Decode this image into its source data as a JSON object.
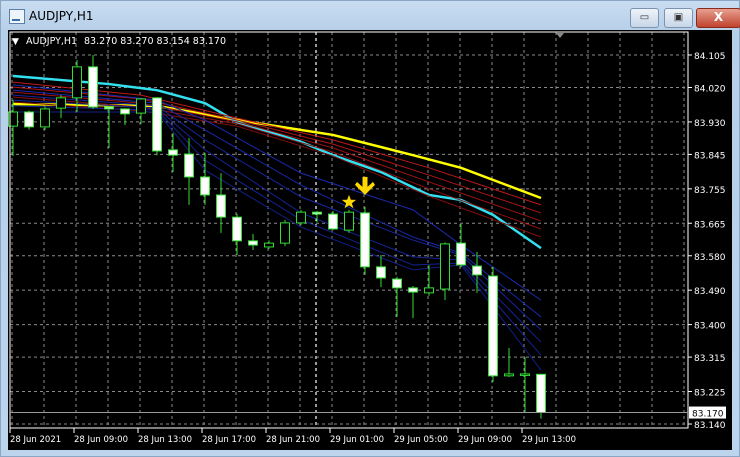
{
  "window": {
    "title": "AUDJPY,H1",
    "minimize_label": "▭",
    "maximize_label": "▣",
    "close_label": "X"
  },
  "chart_header": {
    "symbol": "AUDJPY,H1",
    "ohlc": "83.270 83.270 83.154 83.170"
  },
  "colors": {
    "background": "#000000",
    "candle_outline": "#33dd33",
    "bear_body": "#ffffff",
    "bull_body": "#000000",
    "ma_yellow": "#ffff00",
    "ma_cyan": "#33e0f0",
    "ma_red": "#c01818",
    "ma_blue": "#1020a0",
    "grid": "#8a8a8a"
  },
  "chart_data": {
    "type": "candlestick",
    "symbol": "AUDJPY",
    "timeframe": "H1",
    "ylim": [
      83.14,
      84.105
    ],
    "yticks": [
      "84.105",
      "84.020",
      "83.930",
      "83.845",
      "83.755",
      "83.665",
      "83.580",
      "83.490",
      "83.400",
      "83.315",
      "83.225",
      "83.140"
    ],
    "current_price": "83.170",
    "xtick_labels": [
      {
        "index": 0,
        "label": "28 Jun 2021"
      },
      {
        "index": 4,
        "label": "28 Jun 09:00"
      },
      {
        "index": 8,
        "label": "28 Jun 13:00"
      },
      {
        "index": 12,
        "label": "28 Jun 17:00"
      },
      {
        "index": 16,
        "label": "28 Jun 21:00"
      },
      {
        "index": 20,
        "label": "29 Jun 01:00"
      },
      {
        "index": 24,
        "label": "29 Jun 05:00"
      },
      {
        "index": 28,
        "label": "29 Jun 09:00"
      },
      {
        "index": 32,
        "label": "29 Jun 13:00"
      }
    ],
    "candles": [
      [
        83.919,
        83.987,
        83.841,
        83.956
      ],
      [
        83.956,
        83.96,
        83.91,
        83.917
      ],
      [
        83.917,
        83.97,
        83.909,
        83.964
      ],
      [
        83.966,
        84.0,
        83.94,
        83.993
      ],
      [
        83.993,
        84.092,
        83.956,
        84.074
      ],
      [
        84.074,
        84.105,
        83.964,
        83.969
      ],
      [
        83.969,
        83.972,
        83.862,
        83.964
      ],
      [
        83.964,
        83.966,
        83.922,
        83.951
      ],
      [
        83.953,
        83.993,
        83.925,
        83.99
      ],
      [
        83.993,
        83.995,
        83.843,
        83.854
      ],
      [
        83.857,
        83.901,
        83.799,
        83.843
      ],
      [
        83.846,
        83.888,
        83.713,
        83.786
      ],
      [
        83.786,
        83.849,
        83.713,
        83.739
      ],
      [
        83.739,
        83.796,
        83.64,
        83.681
      ],
      [
        83.681,
        83.69,
        83.582,
        83.619
      ],
      [
        83.619,
        83.637,
        83.595,
        83.608
      ],
      [
        83.603,
        83.62,
        83.598,
        83.613
      ],
      [
        83.613,
        83.674,
        83.605,
        83.666
      ],
      [
        83.666,
        83.7,
        83.66,
        83.694
      ],
      [
        83.694,
        83.697,
        83.668,
        83.689
      ],
      [
        83.689,
        83.697,
        83.647,
        83.65
      ],
      [
        83.647,
        83.7,
        83.64,
        83.694
      ],
      [
        83.692,
        83.708,
        83.53,
        83.551
      ],
      [
        83.551,
        83.582,
        83.498,
        83.522
      ],
      [
        83.519,
        83.525,
        83.42,
        83.496
      ],
      [
        83.496,
        83.501,
        83.417,
        83.485
      ],
      [
        83.483,
        83.556,
        83.475,
        83.496
      ],
      [
        83.493,
        83.615,
        83.464,
        83.611
      ],
      [
        83.613,
        83.663,
        83.55,
        83.556
      ],
      [
        83.553,
        83.59,
        83.483,
        83.53
      ],
      [
        83.527,
        83.551,
        83.25,
        83.266
      ],
      [
        83.266,
        83.339,
        83.263,
        83.271
      ],
      [
        83.271,
        83.315,
        83.171,
        83.271
      ],
      [
        83.27,
        83.27,
        83.154,
        83.17
      ]
    ],
    "moving_averages": [
      {
        "name": "yellow",
        "color": "#ffff00",
        "points": [
          [
            0,
            83.977
          ],
          [
            9,
            83.972
          ],
          [
            14,
            83.935
          ],
          [
            20,
            83.896
          ],
          [
            25,
            83.843
          ],
          [
            28,
            83.81
          ],
          [
            33,
            83.731
          ]
        ]
      },
      {
        "name": "cyan",
        "color": "#33e0f0",
        "points": [
          [
            0,
            84.05
          ],
          [
            6,
            84.029
          ],
          [
            9,
            84.013
          ],
          [
            12,
            83.979
          ],
          [
            14,
            83.93
          ],
          [
            18,
            83.878
          ],
          [
            20,
            83.843
          ],
          [
            23,
            83.799
          ],
          [
            26,
            83.739
          ],
          [
            28,
            83.726
          ],
          [
            30,
            83.687
          ],
          [
            33,
            83.6
          ]
        ]
      },
      {
        "name": "red-1",
        "color": "#c01818",
        "points": [
          [
            0,
            84.034
          ],
          [
            8,
            84.0
          ],
          [
            14,
            83.94
          ],
          [
            20,
            83.883
          ],
          [
            26,
            83.81
          ],
          [
            33,
            83.713
          ]
        ]
      },
      {
        "name": "red-2",
        "color": "#b01515",
        "points": [
          [
            0,
            84.021
          ],
          [
            8,
            83.99
          ],
          [
            14,
            83.935
          ],
          [
            20,
            83.872
          ],
          [
            26,
            83.791
          ],
          [
            33,
            83.692
          ]
        ]
      },
      {
        "name": "red-3",
        "color": "#a01212",
        "points": [
          [
            0,
            84.008
          ],
          [
            8,
            83.979
          ],
          [
            14,
            83.93
          ],
          [
            20,
            83.862
          ],
          [
            26,
            83.773
          ],
          [
            33,
            83.671
          ]
        ]
      },
      {
        "name": "red-4",
        "color": "#901010",
        "points": [
          [
            0,
            83.995
          ],
          [
            8,
            83.969
          ],
          [
            14,
            83.925
          ],
          [
            20,
            83.851
          ],
          [
            26,
            83.755
          ],
          [
            33,
            83.65
          ]
        ]
      },
      {
        "name": "red-5",
        "color": "#800e0e",
        "points": [
          [
            0,
            83.982
          ],
          [
            8,
            83.959
          ],
          [
            14,
            83.919
          ],
          [
            20,
            83.841
          ],
          [
            26,
            83.736
          ],
          [
            33,
            83.629
          ]
        ]
      },
      {
        "name": "blue-1",
        "color": "#1a2ab0",
        "points": [
          [
            0,
            84.027
          ],
          [
            9,
            83.987
          ],
          [
            12,
            83.935
          ],
          [
            18,
            83.796
          ],
          [
            25,
            83.7
          ],
          [
            28,
            83.608
          ],
          [
            33,
            83.464
          ]
        ]
      },
      {
        "name": "blue-2",
        "color": "#1828a8",
        "points": [
          [
            0,
            84.013
          ],
          [
            9,
            83.979
          ],
          [
            12,
            83.909
          ],
          [
            18,
            83.765
          ],
          [
            25,
            83.629
          ],
          [
            28,
            83.587
          ],
          [
            33,
            83.42
          ]
        ]
      },
      {
        "name": "blue-3",
        "color": "#1626a0",
        "points": [
          [
            0,
            84.0
          ],
          [
            9,
            83.972
          ],
          [
            12,
            83.883
          ],
          [
            18,
            83.734
          ],
          [
            25,
            83.621
          ],
          [
            28,
            83.582
          ],
          [
            33,
            83.386
          ]
        ]
      },
      {
        "name": "blue-4",
        "color": "#142498",
        "points": [
          [
            0,
            83.987
          ],
          [
            9,
            83.966
          ],
          [
            12,
            83.857
          ],
          [
            18,
            83.692
          ],
          [
            25,
            83.577
          ],
          [
            28,
            83.569
          ],
          [
            33,
            83.354
          ]
        ]
      },
      {
        "name": "blue-5",
        "color": "#122290",
        "points": [
          [
            0,
            83.972
          ],
          [
            9,
            83.961
          ],
          [
            12,
            83.83
          ],
          [
            18,
            83.674
          ],
          [
            25,
            83.556
          ],
          [
            28,
            83.561
          ],
          [
            33,
            83.32
          ]
        ]
      },
      {
        "name": "blue-6",
        "color": "#102088",
        "points": [
          [
            0,
            83.956
          ],
          [
            9,
            83.956
          ],
          [
            12,
            83.804
          ],
          [
            18,
            83.655
          ],
          [
            25,
            83.543
          ],
          [
            28,
            83.556
          ],
          [
            33,
            83.281
          ]
        ]
      }
    ],
    "signals": [
      {
        "type": "star",
        "index": 21,
        "price": 83.72,
        "color": "#ffd700"
      },
      {
        "type": "down-arrow",
        "index": 22,
        "price": 83.76,
        "color": "#ffd700"
      }
    ]
  }
}
